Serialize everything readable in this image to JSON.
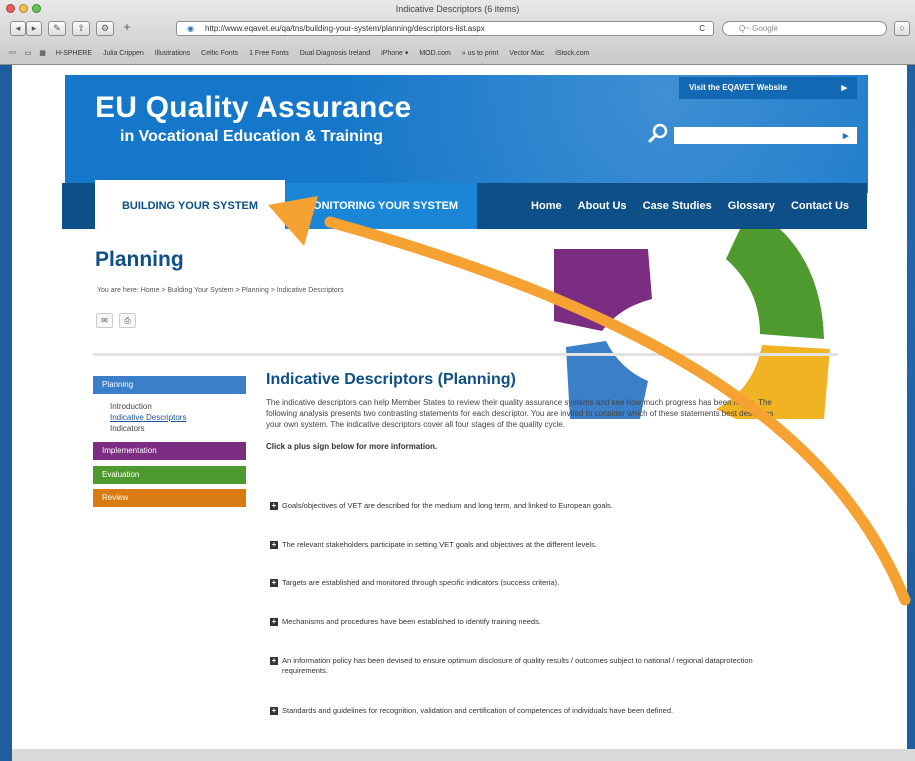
{
  "window": {
    "title": "Indicative Descriptors (6 items)"
  },
  "toolbar": {
    "url": "http://www.eqavet.eu/qa/tns/building-your-system/planning/descriptors-list.aspx",
    "search_placeholder": "Q~ Google",
    "reload": "C"
  },
  "bookmarks": [
    "H-SPHERE",
    "Julia Crippen",
    "Illustrations",
    "Celtic Fonts",
    "1 Free Fonts",
    "Dual Diagnosis Ireland",
    "iPhone ▾",
    "MOD.com",
    "» us to print",
    "Vector Mac",
    "iStock.com"
  ],
  "header": {
    "title": "EU Quality Assurance",
    "subtitle": "in Vocational Education & Training",
    "visit_link": "Visit the EQAVET Website"
  },
  "nav": {
    "tab_building": "BUILDING YOUR SYSTEM",
    "tab_monitoring": "MONITORING YOUR SYSTEM",
    "links": [
      "Home",
      "About Us",
      "Case Studies",
      "Glossary",
      "Contact Us"
    ]
  },
  "page": {
    "title": "Planning",
    "breadcrumb": "You are here: Home > Building Your System > Planning > Indicative Descriptors"
  },
  "sidebar": {
    "planning": "Planning",
    "sub_items": [
      "Introduction",
      "Indicative Descriptors",
      "Indicators"
    ],
    "implementation": "Implementation",
    "evaluation": "Evaluation",
    "review": "Review"
  },
  "content": {
    "title": "Indicative Descriptors (Planning)",
    "intro": "The indicative descriptors can help Member States to review their quality assurance systems and see how much progress has been made. The following analysis presents two contrasting statements for each descriptor. You are invited to consider which of these statements best describes your own system. The indicative descriptors cover all four stages of the quality cycle.",
    "instruction": "Click a plus sign below for more information.",
    "items": [
      "Goals/objectives of VET are described for the medium and long term, and linked to European goals.",
      "The relevant stakeholders participate in setting VET goals and objectives at the different levels.",
      "Targets are established and monitored through specific indicators (success criteria).",
      "Mechanisms and procedures have been established to identify training needs.",
      "An information policy has been devised to ensure optimum disclosure of quality results / outcomes subject to national / regional dataprotection requirements.",
      "Standards and guidelines for recognition, validation and certification of competences of individuals have been defined."
    ]
  },
  "colors": {
    "header_blue": "#1577c9",
    "nav_dark": "#0d4f86",
    "planning": "#3a7fc8",
    "implementation": "#7b2d82",
    "evaluation": "#4f9a2e",
    "review": "#d97a12",
    "arrow": "#f5a233"
  }
}
